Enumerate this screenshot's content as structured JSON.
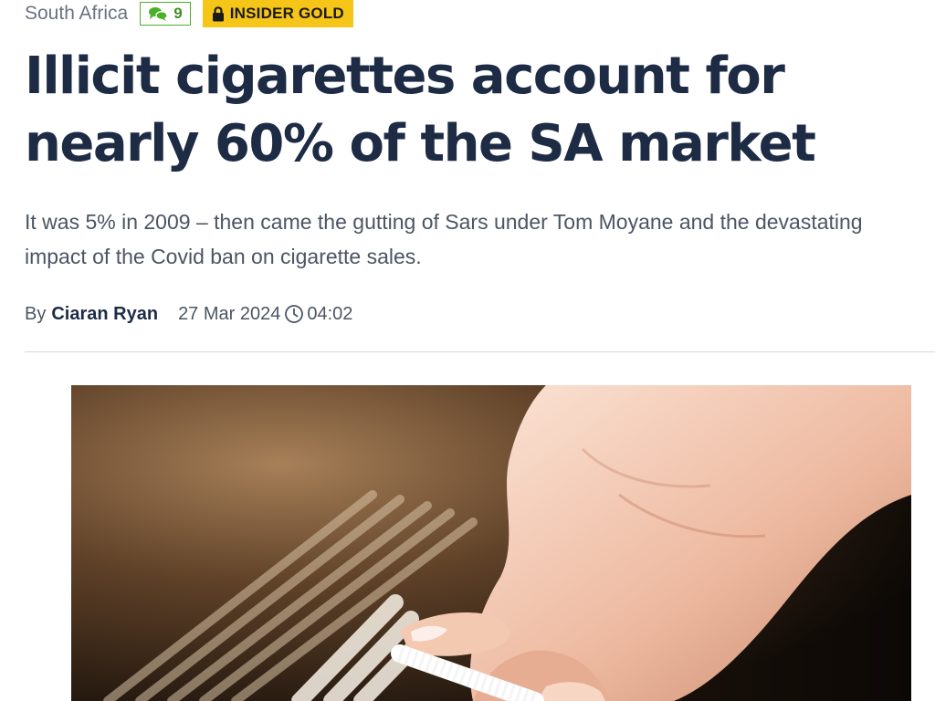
{
  "article": {
    "category": "South Africa",
    "comment_count": "9",
    "badge_label": "INSIDER GOLD",
    "headline": "Illicit cigarettes account for nearly 60% of the SA market",
    "standfirst": "It was 5% in 2009 – then came the gutting of Sars under Tom Moyane and the devastating impact of the Covid ban on cigarette sales.",
    "byline_prefix": "By",
    "author": "Ciaran Ryan",
    "date": "27 Mar 2024",
    "time": "04:02"
  },
  "icons": {
    "comments": "comments-icon",
    "lock": "lock-icon",
    "clock": "clock-icon"
  },
  "colors": {
    "headline": "#1d2b45",
    "badge_background": "#f5c518",
    "comment_accent": "#4caf2a",
    "body_text": "#4b5563",
    "category_text": "#6b7280"
  }
}
